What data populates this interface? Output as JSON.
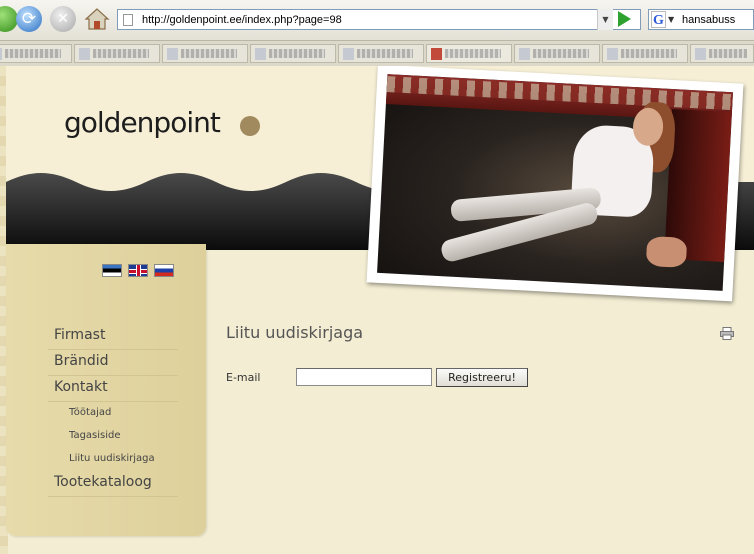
{
  "browser": {
    "url": "http://goldenpoint.ee/index.php?page=98",
    "search_text": "hansabuss",
    "search_engine_letter": "G",
    "tab_count": 9
  },
  "site": {
    "logo_text": "goldenpoint",
    "brand_color": "#a08a5e",
    "languages": [
      "Estonian flag",
      "English flag",
      "Russian flag"
    ]
  },
  "sidebar": {
    "items": [
      {
        "label": "Firmast",
        "level": "main"
      },
      {
        "label": "Brändid",
        "level": "main"
      },
      {
        "label": "Kontakt",
        "level": "main"
      },
      {
        "label": "Töötajad",
        "level": "sub"
      },
      {
        "label": "Tagasiside",
        "level": "sub"
      },
      {
        "label": "Liitu uudiskirjaga",
        "level": "sub"
      },
      {
        "label": "Tootekataloog",
        "level": "main"
      }
    ]
  },
  "content": {
    "title": "Liitu uudiskirjaga",
    "email_label": "E-mail",
    "email_value": "",
    "submit_label": "Registreeru!"
  }
}
